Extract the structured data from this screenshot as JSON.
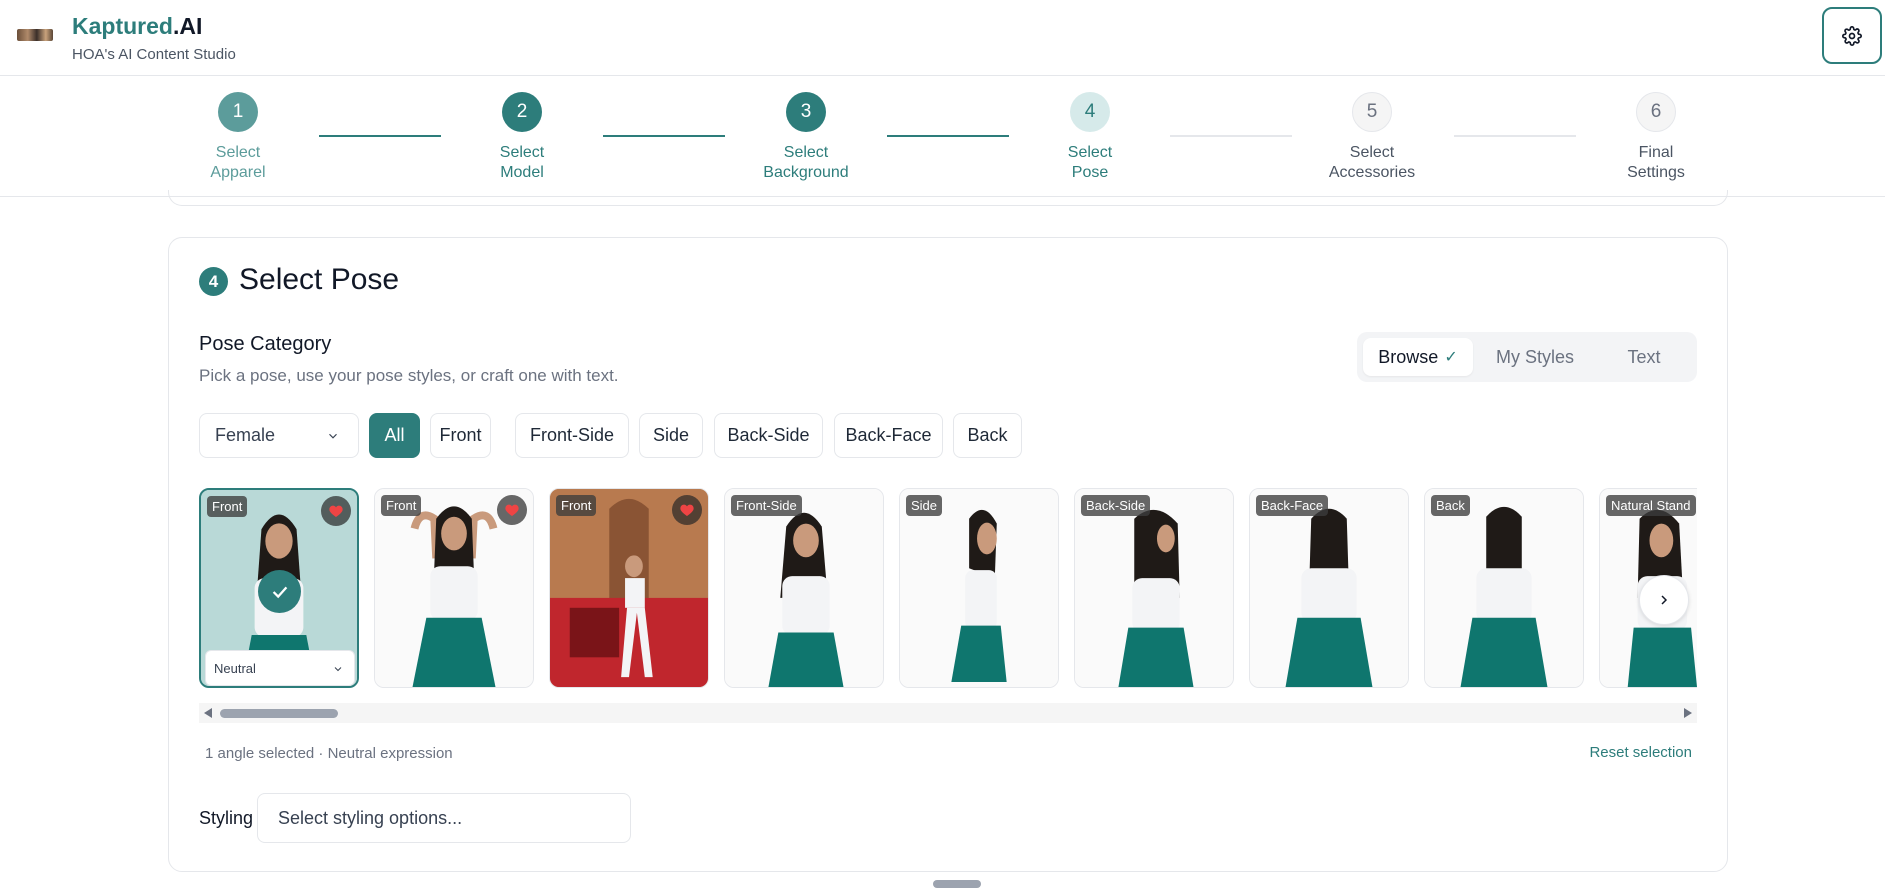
{
  "header": {
    "brand_main": "Kaptured",
    "brand_suffix": ".AI",
    "subtitle": "HOA's AI Content Studio",
    "settings_icon": "gear-icon"
  },
  "stepper": {
    "steps": [
      {
        "num": "1",
        "line1": "Select",
        "line2": "Apparel",
        "state": "done"
      },
      {
        "num": "2",
        "line1": "Select",
        "line2": "Model",
        "state": "done"
      },
      {
        "num": "3",
        "line1": "Select",
        "line2": "Background",
        "state": "done"
      },
      {
        "num": "4",
        "line1": "Select",
        "line2": "Pose",
        "state": "current"
      },
      {
        "num": "5",
        "line1": "Select",
        "line2": "Accessories",
        "state": "todo"
      },
      {
        "num": "6",
        "line1": "Final",
        "line2": "Settings",
        "state": "todo"
      }
    ]
  },
  "section": {
    "number": "4",
    "title": "Select Pose",
    "category_title": "Pose Category",
    "category_subtitle": "Pick a pose, use your pose styles, or craft one with text."
  },
  "mode_toggle": {
    "options": [
      "Browse",
      "My Styles",
      "Text"
    ],
    "active": "Browse"
  },
  "filters": {
    "gender": "Female",
    "chips": [
      "All",
      "Front",
      "Front-Side",
      "Side",
      "Back-Side",
      "Back-Face",
      "Back"
    ],
    "active_chip": "All"
  },
  "poses": [
    {
      "tag": "Front",
      "favorite": true,
      "selected": true,
      "expression": "Neutral"
    },
    {
      "tag": "Front",
      "favorite": true,
      "selected": false
    },
    {
      "tag": "Front",
      "favorite": true,
      "selected": false
    },
    {
      "tag": "Front-Side",
      "favorite": false,
      "selected": false
    },
    {
      "tag": "Side",
      "favorite": false,
      "selected": false
    },
    {
      "tag": "Back-Side",
      "favorite": false,
      "selected": false
    },
    {
      "tag": "Back-Face",
      "favorite": false,
      "selected": false
    },
    {
      "tag": "Back",
      "favorite": false,
      "selected": false
    },
    {
      "tag": "Natural Stand",
      "favorite": false,
      "selected": false
    }
  ],
  "summary": {
    "selection_text": "1 angle selected · Neutral expression",
    "reset_label": "Reset selection"
  },
  "styling": {
    "label": "Styling",
    "placeholder": "Select styling options..."
  },
  "colors": {
    "accent": "#2d7d7b",
    "heart": "#ef4444",
    "skirt": "#0f766e"
  }
}
